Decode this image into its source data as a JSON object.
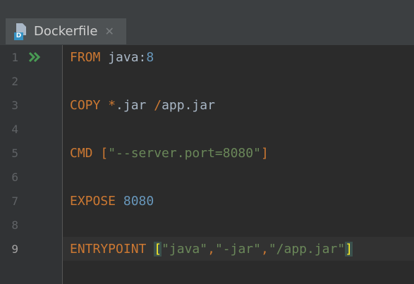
{
  "tab": {
    "title": "Dockerfile",
    "icon": "dockerfile-icon",
    "badge": "D",
    "close_glyph": "✕"
  },
  "editor": {
    "current_line": 9,
    "lines": [
      {
        "number": "1",
        "tokens": [
          {
            "t": "FROM",
            "c": "kw"
          },
          {
            "t": " java:",
            "c": "plain"
          },
          {
            "t": "8",
            "c": "num"
          }
        ]
      },
      {
        "number": "2",
        "tokens": []
      },
      {
        "number": "3",
        "tokens": [
          {
            "t": "COPY",
            "c": "kw"
          },
          {
            "t": " ",
            "c": "plain"
          },
          {
            "t": "*",
            "c": "kw"
          },
          {
            "t": ".jar ",
            "c": "plain"
          },
          {
            "t": "/",
            "c": "kw"
          },
          {
            "t": "app.jar",
            "c": "plain"
          }
        ]
      },
      {
        "number": "4",
        "tokens": []
      },
      {
        "number": "5",
        "tokens": [
          {
            "t": "CMD",
            "c": "kw"
          },
          {
            "t": " ",
            "c": "plain"
          },
          {
            "t": "[",
            "c": "bracket"
          },
          {
            "t": "\"--server.port=8080\"",
            "c": "str"
          },
          {
            "t": "]",
            "c": "bracket"
          }
        ]
      },
      {
        "number": "6",
        "tokens": []
      },
      {
        "number": "7",
        "tokens": [
          {
            "t": "EXPOSE",
            "c": "kw"
          },
          {
            "t": " ",
            "c": "plain"
          },
          {
            "t": "8080",
            "c": "num"
          }
        ]
      },
      {
        "number": "8",
        "tokens": []
      },
      {
        "number": "9",
        "tokens": [
          {
            "t": "ENTRYPOINT",
            "c": "kw"
          },
          {
            "t": " ",
            "c": "plain"
          },
          {
            "t": "[",
            "c": "bracket match"
          },
          {
            "t": "\"java\"",
            "c": "str"
          },
          {
            "t": ",",
            "c": "kw"
          },
          {
            "t": "\"-jar\"",
            "c": "str"
          },
          {
            "t": ",",
            "c": "kw"
          },
          {
            "t": "\"/app.jar\"",
            "c": "str"
          },
          {
            "t": "]",
            "c": "bracket match"
          }
        ]
      }
    ]
  },
  "colors": {
    "background": "#2b2b2b",
    "keyword": "#cc7832",
    "string": "#6a8759",
    "number": "#6897bb",
    "text": "#a9b7c6",
    "run_icon": "#499c54"
  },
  "gutter": {
    "run_icon": "run-gutter-icon"
  }
}
